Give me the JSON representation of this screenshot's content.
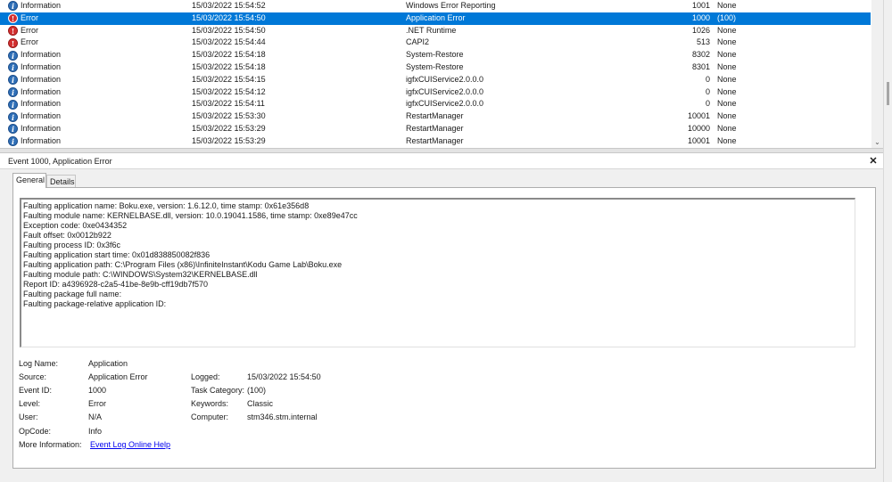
{
  "events": [
    {
      "level": "Information",
      "level_type": "info",
      "date": "15/03/2022 15:54:52",
      "source": "Windows Error Reporting",
      "event_id": "1001",
      "task": "None",
      "selected": false
    },
    {
      "level": "Error",
      "level_type": "err",
      "date": "15/03/2022 15:54:50",
      "source": "Application Error",
      "event_id": "1000",
      "task": "(100)",
      "selected": true
    },
    {
      "level": "Error",
      "level_type": "err",
      "date": "15/03/2022 15:54:50",
      "source": ".NET Runtime",
      "event_id": "1026",
      "task": "None",
      "selected": false
    },
    {
      "level": "Error",
      "level_type": "err",
      "date": "15/03/2022 15:54:44",
      "source": "CAPI2",
      "event_id": "513",
      "task": "None",
      "selected": false
    },
    {
      "level": "Information",
      "level_type": "info",
      "date": "15/03/2022 15:54:18",
      "source": "System-Restore",
      "event_id": "8302",
      "task": "None",
      "selected": false
    },
    {
      "level": "Information",
      "level_type": "info",
      "date": "15/03/2022 15:54:18",
      "source": "System-Restore",
      "event_id": "8301",
      "task": "None",
      "selected": false
    },
    {
      "level": "Information",
      "level_type": "info",
      "date": "15/03/2022 15:54:15",
      "source": "igfxCUIService2.0.0.0",
      "event_id": "0",
      "task": "None",
      "selected": false
    },
    {
      "level": "Information",
      "level_type": "info",
      "date": "15/03/2022 15:54:12",
      "source": "igfxCUIService2.0.0.0",
      "event_id": "0",
      "task": "None",
      "selected": false
    },
    {
      "level": "Information",
      "level_type": "info",
      "date": "15/03/2022 15:54:11",
      "source": "igfxCUIService2.0.0.0",
      "event_id": "0",
      "task": "None",
      "selected": false
    },
    {
      "level": "Information",
      "level_type": "info",
      "date": "15/03/2022 15:53:30",
      "source": "RestartManager",
      "event_id": "10001",
      "task": "None",
      "selected": false
    },
    {
      "level": "Information",
      "level_type": "info",
      "date": "15/03/2022 15:53:29",
      "source": "RestartManager",
      "event_id": "10000",
      "task": "None",
      "selected": false
    },
    {
      "level": "Information",
      "level_type": "info",
      "date": "15/03/2022 15:53:29",
      "source": "RestartManager",
      "event_id": "10001",
      "task": "None",
      "selected": false
    }
  ],
  "scrollbar": {
    "down_arrow": "⌄"
  },
  "detail": {
    "title": "Event 1000, Application Error",
    "close_glyph": "✕",
    "tabs": {
      "general": "General",
      "details": "Details"
    },
    "description": [
      "Faulting application name: Boku.exe, version: 1.6.12.0, time stamp: 0x61e356d8",
      "Faulting module name: KERNELBASE.dll, version: 10.0.19041.1586, time stamp: 0xe89e47cc",
      "Exception code: 0xe0434352",
      "Fault offset: 0x0012b922",
      "Faulting process ID: 0x3f6c",
      "Faulting application start time: 0x01d838850082f836",
      "Faulting application path: C:\\Program Files (x86)\\InfiniteInstant\\Kodu Game Lab\\Boku.exe",
      "Faulting module path: C:\\WINDOWS\\System32\\KERNELBASE.dll",
      "Report ID: a4396928-c2a5-41be-8e9b-cff19db7f570",
      "Faulting package full name: ",
      "Faulting package-relative application ID: "
    ],
    "fields": {
      "log_name_label": "Log Name:",
      "log_name": "Application",
      "source_label": "Source:",
      "source": "Application Error",
      "logged_label": "Logged:",
      "logged": "15/03/2022 15:54:50",
      "event_id_label": "Event ID:",
      "event_id": "1000",
      "task_category_label": "Task Category:",
      "task_category": "(100)",
      "level_label": "Level:",
      "level": "Error",
      "keywords_label": "Keywords:",
      "keywords": "Classic",
      "user_label": "User:",
      "user": "N/A",
      "computer_label": "Computer:",
      "computer": "stm346.stm.internal",
      "opcode_label": "OpCode:",
      "opcode": "Info",
      "more_info_label": "More Information:",
      "more_info_link": "Event Log Online Help"
    }
  },
  "colors": {
    "selection": "#0078d7",
    "info_icon": "#2f6fb7",
    "error_icon": "#d32f2f",
    "link": "#0000ee"
  }
}
